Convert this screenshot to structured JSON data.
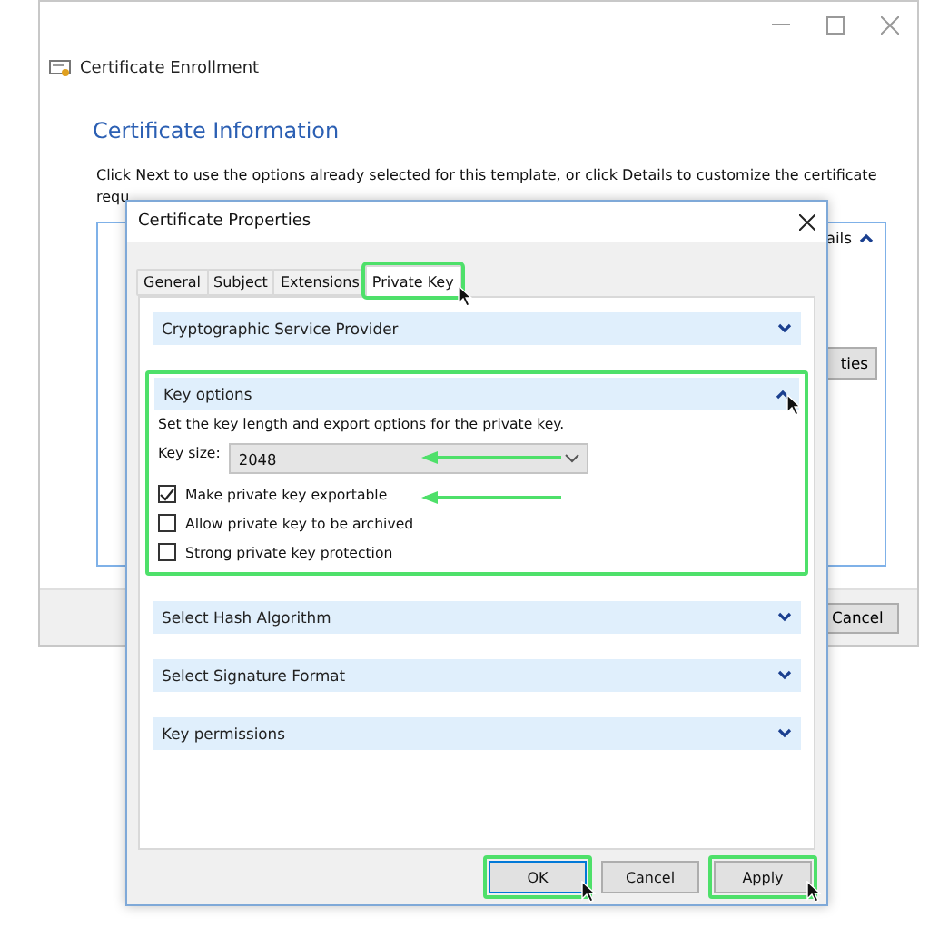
{
  "background_window": {
    "title": "Certificate Enrollment",
    "heading": "Certificate Information",
    "intro_lines": [
      "Click Next to use the options already selected for this template, or click Details to customize the certificate",
      "requ"
    ],
    "list_header": {
      "text": "ails",
      "expanded": true
    },
    "side_button": "ties",
    "cancel_button": "Cancel"
  },
  "dialog": {
    "title": "Certificate Properties",
    "tabs": [
      {
        "label": "General",
        "selected": false,
        "highlighted": false,
        "cursor": false
      },
      {
        "label": "Subject",
        "selected": false,
        "highlighted": false,
        "cursor": false
      },
      {
        "label": "Extensions",
        "selected": false,
        "highlighted": false,
        "cursor": false
      },
      {
        "label": "Private Key",
        "selected": true,
        "highlighted": true,
        "cursor": true
      }
    ],
    "sections": [
      {
        "title": "Cryptographic Service Provider",
        "expanded": false,
        "highlighted": false,
        "cursor": false
      },
      {
        "title": "Key options",
        "expanded": true,
        "highlighted": true,
        "cursor": true,
        "description": "Set the key length and export options for the private key.",
        "key_size": {
          "label": "Key size:",
          "value": "2048",
          "annotated": true
        },
        "options": [
          {
            "label": "Make private key exportable",
            "checked": true,
            "annotated": true
          },
          {
            "label": "Allow private key to be archived",
            "checked": false,
            "annotated": false
          },
          {
            "label": "Strong private key protection",
            "checked": false,
            "annotated": false
          }
        ]
      },
      {
        "title": "Select Hash Algorithm",
        "expanded": false,
        "highlighted": false,
        "cursor": false
      },
      {
        "title": "Select Signature Format",
        "expanded": false,
        "highlighted": false,
        "cursor": false
      },
      {
        "title": "Key permissions",
        "expanded": false,
        "highlighted": false,
        "cursor": false
      }
    ],
    "buttons": [
      {
        "label": "OK",
        "default": true,
        "highlighted": true,
        "cursor": true
      },
      {
        "label": "Cancel",
        "default": false,
        "highlighted": false,
        "cursor": false
      },
      {
        "label": "Apply",
        "default": false,
        "highlighted": true,
        "cursor": true
      }
    ]
  }
}
